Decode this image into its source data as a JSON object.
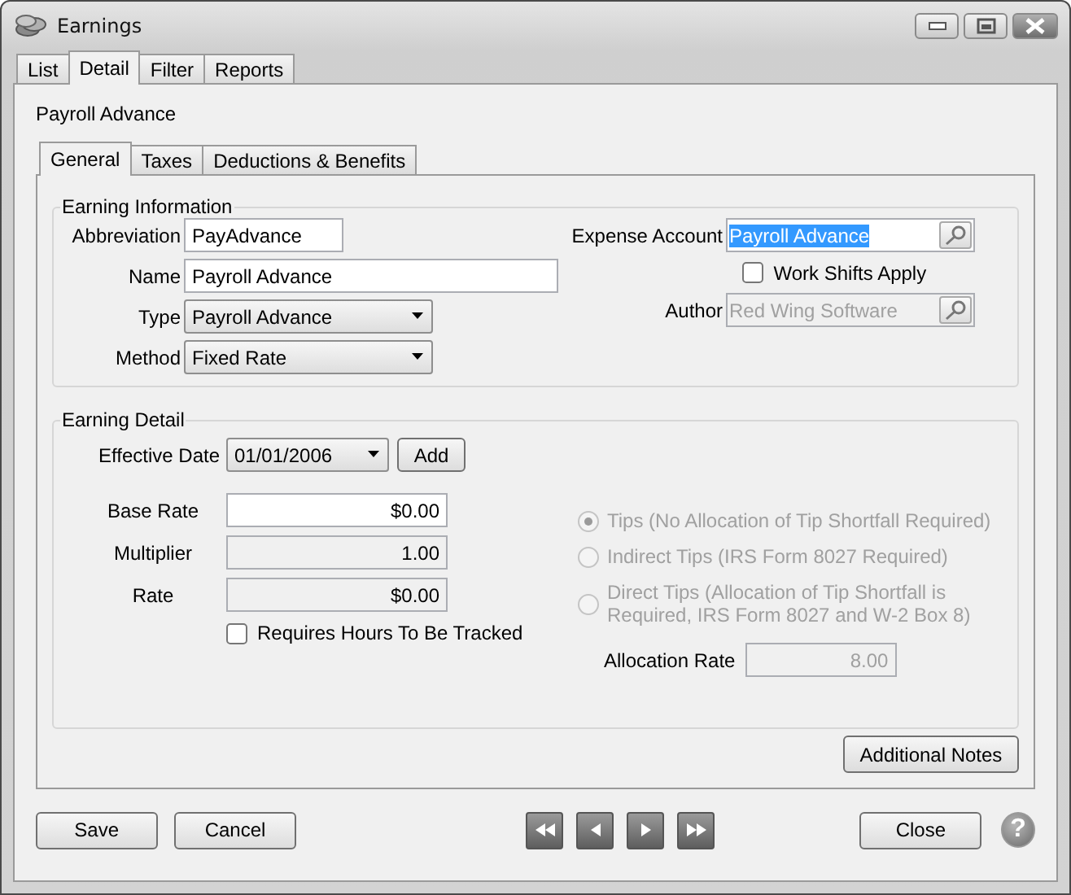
{
  "window": {
    "title": "Earnings"
  },
  "tabs": [
    {
      "label": "List",
      "selected": false
    },
    {
      "label": "Detail",
      "selected": true
    },
    {
      "label": "Filter",
      "selected": false
    },
    {
      "label": "Reports",
      "selected": false
    }
  ],
  "record_title": "Payroll Advance",
  "subtabs": [
    {
      "label": "General",
      "selected": true
    },
    {
      "label": "Taxes",
      "selected": false
    },
    {
      "label": "Deductions & Benefits",
      "selected": false
    }
  ],
  "earning_information": {
    "title": "Earning Information",
    "abbreviation": {
      "label": "Abbreviation",
      "value": "PayAdvance"
    },
    "name": {
      "label": "Name",
      "value": "Payroll Advance"
    },
    "type": {
      "label": "Type",
      "value": "Payroll Advance"
    },
    "method": {
      "label": "Method",
      "value": "Fixed Rate"
    },
    "expense_account": {
      "label": "Expense Account",
      "value": "Payroll Advance",
      "highlighted": true,
      "disabled": false
    },
    "work_shifts": {
      "label": "Work Shifts Apply",
      "checked": false
    },
    "author": {
      "label": "Author",
      "value": "Red Wing Software",
      "highlighted": false,
      "disabled": true
    }
  },
  "earning_detail": {
    "title": "Earning Detail",
    "effective_date": {
      "label": "Effective Date",
      "value": "01/01/2006"
    },
    "add_button": "Add",
    "base_rate": {
      "label": "Base Rate",
      "value": "$0.00",
      "readonly": false
    },
    "multiplier": {
      "label": "Multiplier",
      "value": "1.00",
      "readonly": true
    },
    "rate": {
      "label": "Rate",
      "value": "$0.00",
      "readonly": true
    },
    "requires_hours": {
      "label": "Requires Hours To Be Tracked",
      "checked": false
    },
    "tip_options": [
      {
        "label": "Tips (No Allocation of Tip Shortfall Required)",
        "selected": true,
        "disabled": true
      },
      {
        "label": "Indirect Tips (IRS Form 8027 Required)",
        "selected": false,
        "disabled": true
      },
      {
        "label": "Direct Tips (Allocation of Tip Shortfall is Required, IRS Form 8027 and W-2 Box 8)",
        "selected": false,
        "disabled": true
      }
    ],
    "allocation_rate": {
      "label": "Allocation Rate",
      "value": "8.00",
      "disabled": true
    }
  },
  "additional_notes_button": "Additional Notes",
  "buttons": {
    "save": "Save",
    "cancel": "Cancel",
    "close": "Close",
    "help": "?"
  }
}
